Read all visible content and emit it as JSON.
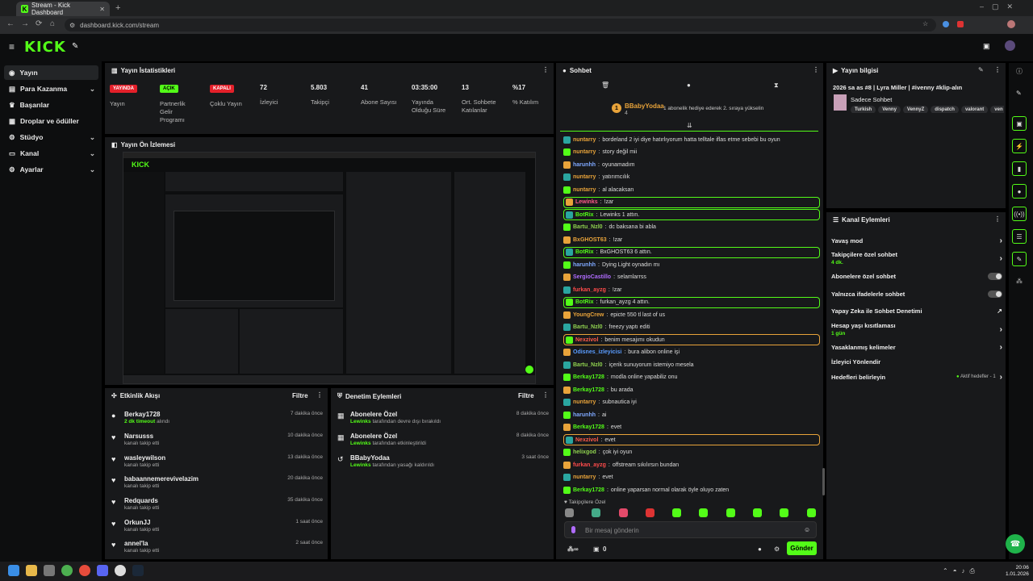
{
  "browser": {
    "tab_title": "Stream - Kick Dashboard",
    "url": "dashboard.kick.com/stream"
  },
  "brand": {
    "logo": "KICK",
    "accent": "#53fc18"
  },
  "sidebar": {
    "items": [
      {
        "label": "Yayın",
        "icon": "broadcast-icon"
      },
      {
        "label": "Para Kazanma",
        "icon": "money-icon"
      },
      {
        "label": "Başarılar",
        "icon": "trophy-icon"
      },
      {
        "label": "Droplar ve ödüller",
        "icon": "gift-icon"
      },
      {
        "label": "Stüdyo",
        "icon": "studio-icon"
      },
      {
        "label": "Kanal",
        "icon": "channel-icon"
      },
      {
        "label": "Ayarlar",
        "icon": "gear-icon"
      }
    ]
  },
  "stats": {
    "title": "Yayın İstatistikleri",
    "items": [
      {
        "badge": "YAYINDA",
        "label": "Yayın"
      },
      {
        "badge": "AÇIK",
        "label": "Partnerlik Gelir Programı"
      },
      {
        "badge": "KAPALI",
        "label": "Çoklu Yayın"
      },
      {
        "value": "72",
        "label": "İzleyici"
      },
      {
        "value": "5.803",
        "label": "Takipçi"
      },
      {
        "value": "41",
        "label": "Abone Sayısı"
      },
      {
        "value": "03:35:00",
        "label": "Yayında Olduğu Süre"
      },
      {
        "value": "13",
        "label": "Ort. Sohbete Katılanlar"
      },
      {
        "value": "%17",
        "label": "% Katılım"
      }
    ]
  },
  "preview": {
    "title": "Yayın Ön İzlemesi"
  },
  "activity": {
    "title": "Etkinlik Akışı",
    "filter": "Filtre",
    "items": [
      {
        "name": "Berkay1728",
        "sub": "2 dk timeout",
        "sub2": "alındı",
        "time": "7 dakika önce",
        "icon": "timeout-icon"
      },
      {
        "name": "Narsusss",
        "sub": "kanalı takip etti",
        "time": "10 dakika önce",
        "icon": "heart-icon"
      },
      {
        "name": "wasleywilson",
        "sub": "kanalı takip etti",
        "time": "13 dakika önce",
        "icon": "heart-icon"
      },
      {
        "name": "babaannemerevivelazim",
        "sub": "kanalı takip etti",
        "time": "20 dakika önce",
        "icon": "heart-icon"
      },
      {
        "name": "Redquards",
        "sub": "kanalı takip etti",
        "time": "35 dakika önce",
        "icon": "heart-icon"
      },
      {
        "name": "OrkunJJ",
        "sub": "kanalı takip etti",
        "time": "1 saat önce",
        "icon": "heart-icon"
      },
      {
        "name": "annel'la",
        "sub": "kanalı takip etti",
        "time": "2 saat önce",
        "icon": "heart-icon"
      }
    ]
  },
  "moderation": {
    "title": "Denetim Eylemleri",
    "filter": "Filtre",
    "items": [
      {
        "name": "Abonelere Özel",
        "user": "Lewinks",
        "sub": "tarafından devre dışı bırakıldı",
        "time": "8 dakika önce"
      },
      {
        "name": "Abonelere Özel",
        "user": "Lewinks",
        "sub": "tarafından etkinleştirildi",
        "time": "8 dakika önce"
      },
      {
        "name": "BBabyYodaa",
        "user": "Lewinks",
        "sub": "tarafından yasağı kaldırıldı",
        "time": "3 saat önce"
      }
    ]
  },
  "chat": {
    "title": "Sohbet",
    "top_user": "BBabyYodaa",
    "top_count": "4",
    "top_note": "1 abonelik hediye ederek 2. sıraya yükselin",
    "messages": [
      {
        "user": "nuntarry",
        "color": "#e8a33a",
        "text": "bordeland 2 iyi diye hatırlıyorum hatta telltale iflas etme sebebi bu oyun"
      },
      {
        "user": "nuntarry",
        "color": "#e8a33a",
        "text": "story değil mii"
      },
      {
        "user": "harunhh",
        "color": "#7fa8ff",
        "text": "oyunamadım"
      },
      {
        "user": "nuntarry",
        "color": "#e8a33a",
        "text": "yatırımcılık"
      },
      {
        "user": "nuntarry",
        "color": "#e8a33a",
        "text": "al alacaksan"
      },
      {
        "user": "Lewinks",
        "color": "#ff5a8a",
        "text": "!zar",
        "hl": "#53fc18"
      },
      {
        "user": "BotRix",
        "color": "#53fc18",
        "text": "Lewinks 1 attın.",
        "hl": "#53fc18"
      },
      {
        "user": "Bartu_Nzl0",
        "color": "#8fd14f",
        "text": "dc baksana bi abla"
      },
      {
        "user": "BxGHOST63",
        "color": "#e8a33a",
        "text": "!zar"
      },
      {
        "user": "BotRix",
        "color": "#53fc18",
        "text": "BxGHOST63 6 attın.",
        "hl": "#53fc18"
      },
      {
        "user": "harunhh",
        "color": "#7fa8ff",
        "text": "Dying Light oynadın mı"
      },
      {
        "user": "SergioCastillo",
        "color": "#b06cff",
        "text": "selamlarrss"
      },
      {
        "user": "furkan_ayzg",
        "color": "#ff4b4b",
        "text": "!zar"
      },
      {
        "user": "BotRix",
        "color": "#53fc18",
        "text": "furkan_ayzg 4 attın.",
        "hl": "#53fc18"
      },
      {
        "user": "YoungCrew",
        "color": "#e8a33a",
        "text": "epicte 550 tl last of us"
      },
      {
        "user": "Bartu_Nzl0",
        "color": "#8fd14f",
        "text": "freezy yaptı editi"
      },
      {
        "user": "Nexzivol",
        "color": "#ff5a4a",
        "text": "benim mesajımı okudun",
        "hl": "#e8a33a"
      },
      {
        "user": "Odisnes_izleyicisi",
        "color": "#5a9cff",
        "text": "bura alibon online işi"
      },
      {
        "user": "Bartu_Nzl0",
        "color": "#8fd14f",
        "text": "içerik sunuyorum istemiyo mesela"
      },
      {
        "user": "Berkay1728",
        "color": "#53fc18",
        "text": "modla online yapabiliz onu"
      },
      {
        "user": "Berkay1728",
        "color": "#53fc18",
        "text": "bu arada"
      },
      {
        "user": "nuntarry",
        "color": "#e8a33a",
        "text": "subnautica iyi"
      },
      {
        "user": "harunhh",
        "color": "#7fa8ff",
        "text": "ai"
      },
      {
        "user": "Berkay1728",
        "color": "#53fc18",
        "text": "evet"
      },
      {
        "user": "Nexzivol",
        "color": "#ff5a4a",
        "text": "evet",
        "hl": "#e8a33a"
      },
      {
        "user": "helixgod",
        "color": "#8fd14f",
        "text": "çok iyi oyun"
      },
      {
        "user": "furkan_ayzg",
        "color": "#ff4b4b",
        "text": "offstream sıkılırsın bundan"
      },
      {
        "user": "nuntarry",
        "color": "#e8a33a",
        "text": "evet"
      },
      {
        "user": "Berkay1728",
        "color": "#53fc18",
        "text": "online yaparsan normal olarak öyle oluyo zaten"
      }
    ],
    "followers_only": "Takipçilere Özel",
    "input_placeholder": "Bir mesaj gönderin",
    "send": "Gönder",
    "count": "0"
  },
  "stream_info": {
    "title": "Yayın bilgisi",
    "stream_title": "2026 sa as #8 | Lyra Miller | #ivenny #klip-alın",
    "category": "Sadece Sohbet",
    "tags": [
      "Turkish",
      "Venny",
      "VennyZ",
      "dispatch",
      "valorant",
      "ven"
    ]
  },
  "channel_actions": {
    "title": "Kanal Eylemleri",
    "items": [
      {
        "label": "Yavaş mod",
        "type": "arrow"
      },
      {
        "label": "Takipçilere özel sohbet",
        "sub": "4 dk.",
        "type": "arrow"
      },
      {
        "label": "Abonelere özel sohbet",
        "type": "toggle"
      },
      {
        "label": "Yalnızca ifadelerle sohbet",
        "type": "toggle"
      },
      {
        "label": "Yapay Zeka ile Sohbet Denetimi",
        "type": "ext"
      },
      {
        "label": "Hesap yaşı kısıtlaması",
        "sub": "1 gün",
        "type": "arrow"
      },
      {
        "label": "Yasaklanmış kelimeler",
        "type": "arrow"
      },
      {
        "label": "İzleyici Yönlendir",
        "type": "none"
      },
      {
        "label": "Hedefleri belirleyin",
        "extra": "Aktif hedefler - 1",
        "type": "arrow"
      }
    ]
  },
  "taskbar": {
    "time": "20:06",
    "date": "1.01.2026"
  }
}
